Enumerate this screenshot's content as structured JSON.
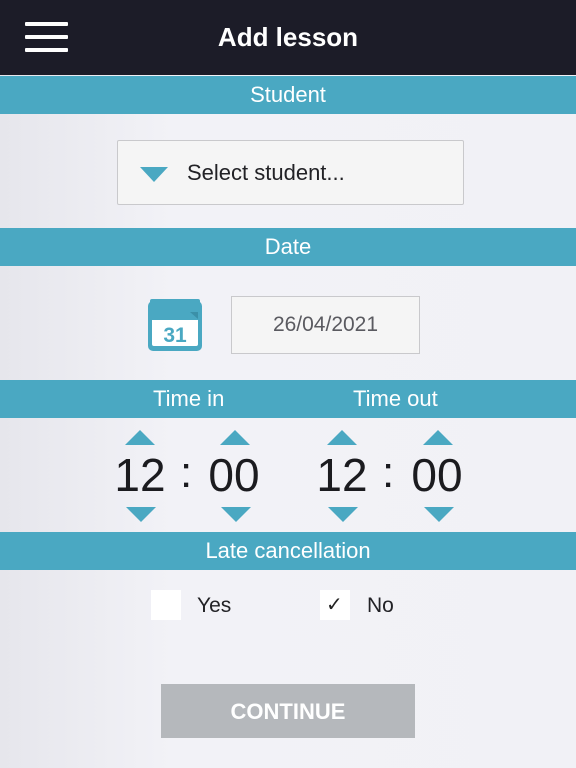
{
  "header": {
    "title": "Add lesson",
    "menu_icon": "hamburger-menu-icon"
  },
  "sections": {
    "student": "Student",
    "date": "Date",
    "time_in": "Time in",
    "time_out": "Time out",
    "late_cancellation": "Late cancellation"
  },
  "student_select": {
    "placeholder": "Select student...",
    "icon": "dropdown-triangle-icon"
  },
  "date": {
    "value": "26/04/2021",
    "calendar_day": "31",
    "icon": "calendar-icon"
  },
  "time_in": {
    "hours": "12",
    "separator": ":",
    "minutes": "00"
  },
  "time_out": {
    "hours": "12",
    "separator": ":",
    "minutes": "00"
  },
  "late_cancellation": {
    "yes_label": "Yes",
    "no_label": "No",
    "yes_checked": false,
    "no_checked": true,
    "check_glyph": "✓"
  },
  "continue": {
    "label": "CONTINUE",
    "enabled": false
  },
  "colors": {
    "accent": "#4aa8c2",
    "topbar": "#1c1c28",
    "button_disabled": "#b5b8bc"
  }
}
